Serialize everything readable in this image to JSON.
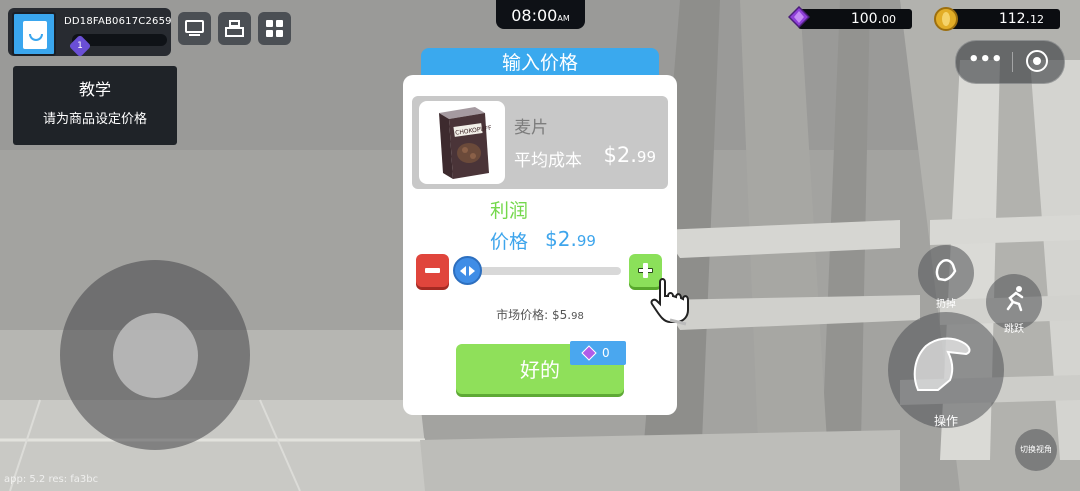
{
  "player": {
    "id": "DD18FAB0617C2659",
    "level": "1"
  },
  "toolbar": {
    "icons": [
      "monitor-icon",
      "cash-register-icon",
      "grid-icon"
    ]
  },
  "tutorial": {
    "title": "教学",
    "text": "请为商品设定价格"
  },
  "clock": {
    "time": "08:00",
    "suffix": "AM"
  },
  "currency": {
    "gems": {
      "main": "100.",
      "cents": "00"
    },
    "coins": {
      "main": "112.",
      "cents": "12"
    }
  },
  "dialog": {
    "title": "输入价格",
    "item_name": "麦片",
    "avg_cost_label": "平均成本",
    "avg_cost": {
      "main": "$2.",
      "cents": "99"
    },
    "profit_label": "利润",
    "price_label": "价格",
    "price": {
      "main": "$2.",
      "cents": "99"
    },
    "market_label": "市场价格:",
    "market_price": {
      "main": "$5.",
      "cents": "98"
    },
    "confirm_label": "好的",
    "gem_cost": "0",
    "product_box_text": "CHOKOPUFF"
  },
  "actions": {
    "throw_label": "扔掉",
    "jump_label": "跳跃",
    "operate_label": "操作",
    "switch_view_label": "切换视角"
  },
  "menu": {
    "dots": "•••"
  },
  "footer": {
    "version": "app: 5.2 res: fa3bc"
  },
  "colors": {
    "accent_blue": "#3aa9ee",
    "green": "#8fe05a",
    "red": "#e0453c",
    "gem_purple": "#8e3fd8",
    "coin_gold": "#e2ad27"
  }
}
